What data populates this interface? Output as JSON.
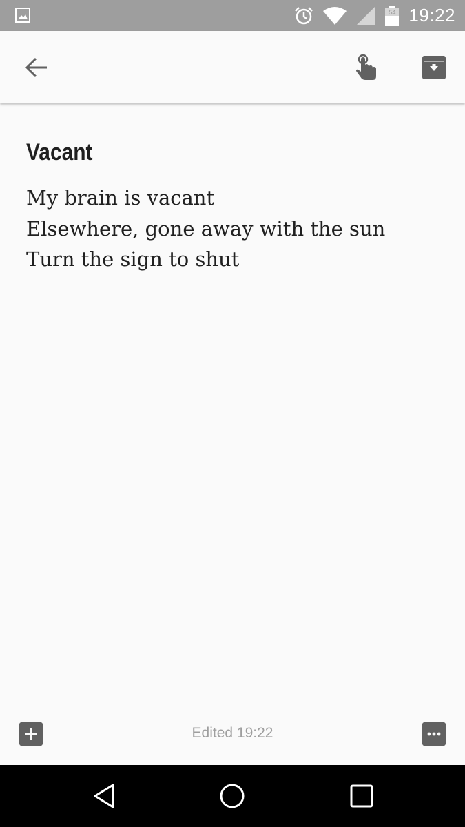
{
  "status_bar": {
    "time": "19:22",
    "battery_level": "54",
    "icons": [
      "image-notification-icon",
      "alarm-icon",
      "wifi-icon",
      "signal-icon",
      "battery-icon"
    ]
  },
  "app_bar": {
    "icons": [
      "back-arrow-icon",
      "reminder-icon",
      "archive-icon"
    ]
  },
  "note": {
    "title": "Vacant",
    "lines": [
      "My brain is vacant",
      "Elsewhere, gone away with the sun",
      "Turn the sign to shut"
    ]
  },
  "bottom_bar": {
    "edited_label": "Edited 19:22",
    "icons": [
      "add-box-icon",
      "more-options-icon"
    ]
  },
  "nav_bar": {
    "icons": [
      "nav-back-icon",
      "nav-home-icon",
      "nav-recents-icon"
    ]
  },
  "colors": {
    "status_bar": "#9e9e9e",
    "background": "#fafafa",
    "text": "#202020",
    "icon": "#616161",
    "muted_text": "#9e9e9e",
    "nav_bar": "#000000"
  }
}
